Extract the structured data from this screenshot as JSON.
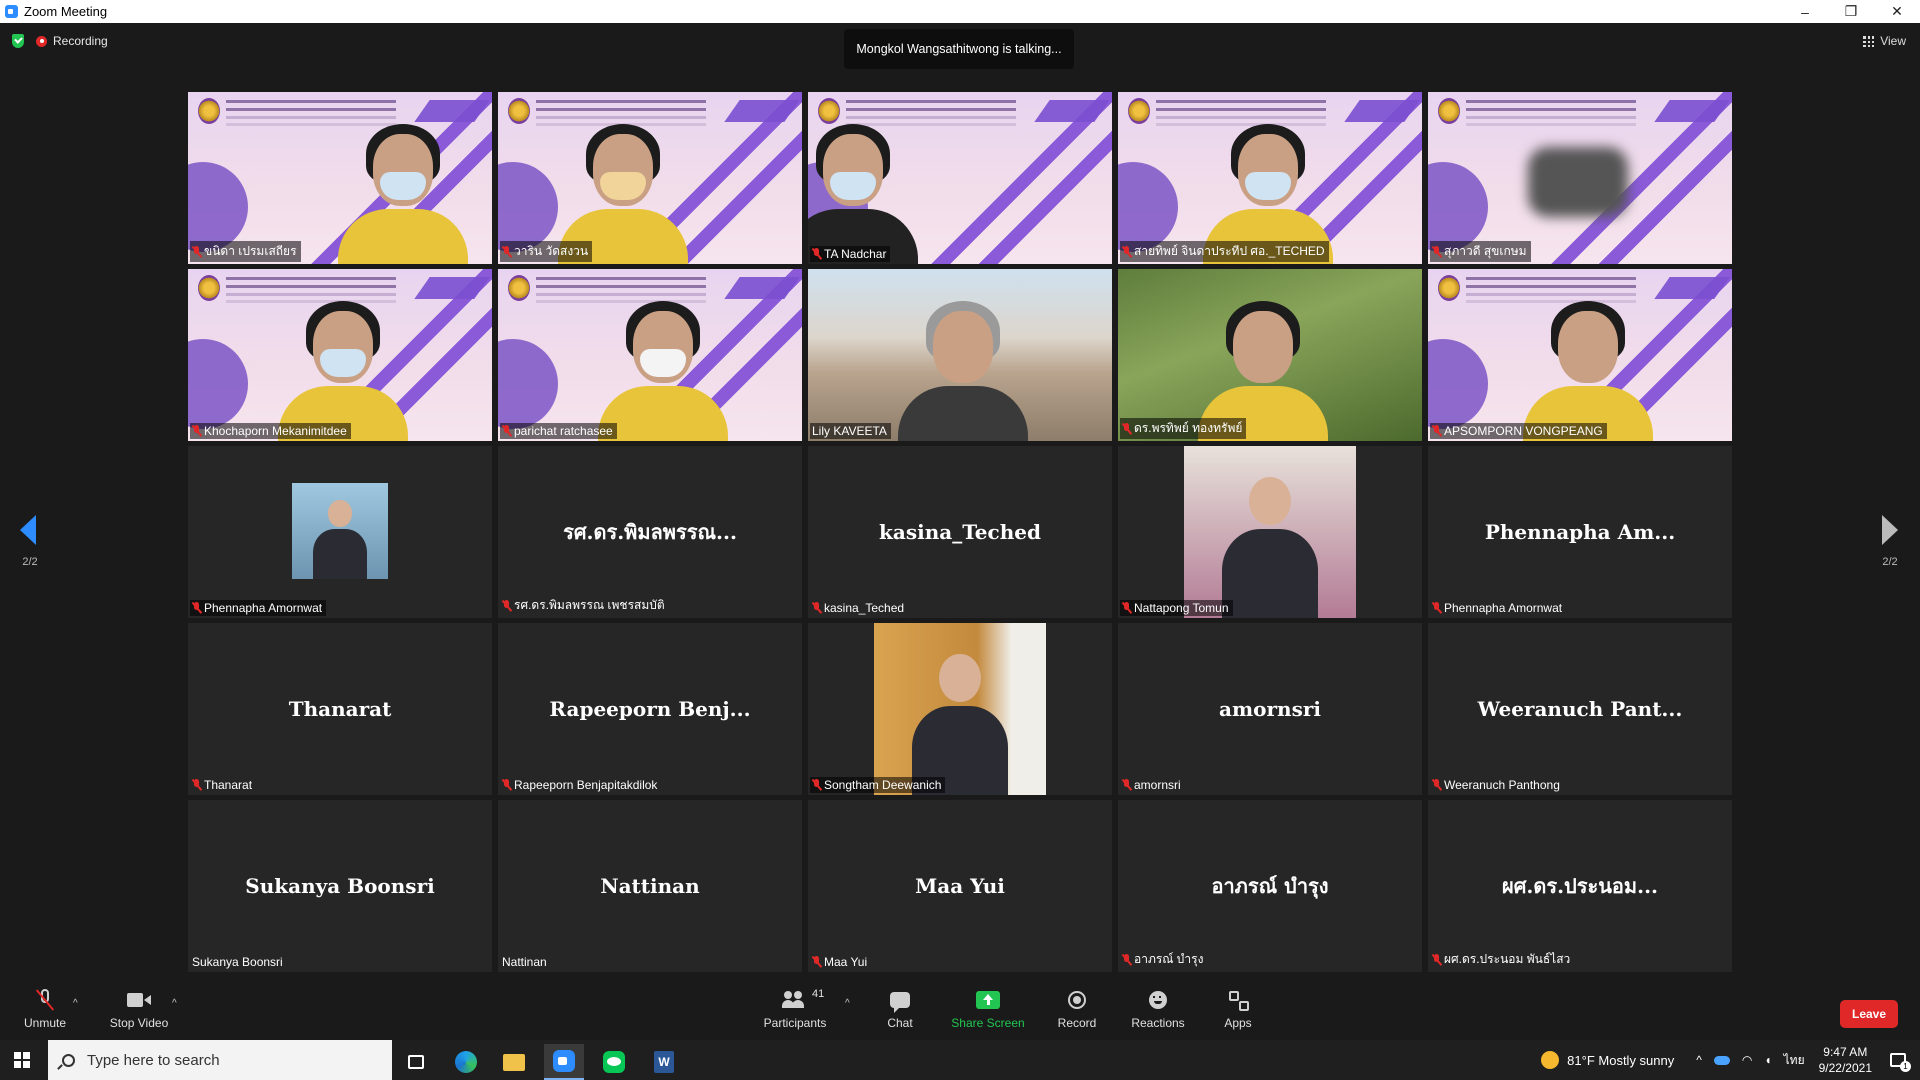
{
  "window": {
    "title": "Zoom Meeting",
    "controls": {
      "minimize": "–",
      "restore": "❐",
      "close": "✕"
    }
  },
  "top_bar": {
    "recording_label": "Recording",
    "talking_text": "Mongkol Wangsathitwong is talking...",
    "view_label": "View"
  },
  "pagination": {
    "left": "2/2",
    "right": "2/2"
  },
  "tiles": [
    {
      "name": "ขนิดา เปรมเสถียร",
      "kind": "video"
    },
    {
      "name": "วาริน วัดสงวน",
      "kind": "video"
    },
    {
      "name": "TA Nadchar",
      "kind": "video"
    },
    {
      "name": "สายทิพย์ จินดาประทีป ศอ._TECHED",
      "kind": "video"
    },
    {
      "name": "สุภาวดี สุขเกษม",
      "kind": "video"
    },
    {
      "name": "Khochaporn Mekanimitdee",
      "kind": "video"
    },
    {
      "name": "parichat ratchasee",
      "kind": "video"
    },
    {
      "name": "Lily KAVEETA",
      "kind": "video"
    },
    {
      "name": "ดร.พรทิพย์ ทองทรัพย์",
      "kind": "video"
    },
    {
      "name": "APSOMPORN VONGPEANG",
      "kind": "video"
    },
    {
      "name": "Phennapha Amornwat",
      "kind": "photo"
    },
    {
      "name": "รศ.ดร.พิมลพรรณ เพชรสมบัติ",
      "display_name": "รศ.ดร.พิมลพรรณ...",
      "kind": "name"
    },
    {
      "name": "kasina_Teched",
      "display_name": "kasina_Teched",
      "kind": "name"
    },
    {
      "name": "Nattapong Tomun",
      "kind": "photo"
    },
    {
      "name": "Phennapha  Amornwat",
      "display_name": "Phennapha  Am...",
      "kind": "name"
    },
    {
      "name": "Thanarat",
      "display_name": "Thanarat",
      "kind": "name"
    },
    {
      "name": "Rapeeporn Benjapitakdilok",
      "display_name": "Rapeeporn  Benj...",
      "kind": "name"
    },
    {
      "name": "Songtham Deewanich",
      "kind": "photo"
    },
    {
      "name": "amornsri",
      "display_name": "amornsri",
      "kind": "name"
    },
    {
      "name": "Weeranuch Panthong",
      "display_name": "Weeranuch  Pant...",
      "kind": "name"
    },
    {
      "name": "Sukanya Boonsri",
      "display_name": "Sukanya Boonsri",
      "kind": "name",
      "muted": false
    },
    {
      "name": "Nattinan",
      "display_name": "Nattinan",
      "kind": "name",
      "muted": false
    },
    {
      "name": "Maa Yui",
      "display_name": "Maa Yui",
      "kind": "name"
    },
    {
      "name": "อาภรณ์ บำรุง",
      "display_name": "อาภรณ์ บำรุง",
      "kind": "name"
    },
    {
      "name": "ผศ.ดร.ประนอม พันธ์ไสว",
      "display_name": "ผศ.ดร.ประนอม...",
      "kind": "name"
    }
  ],
  "toolbar": {
    "unmute": "Unmute",
    "stop_video": "Stop Video",
    "participants": "Participants",
    "participant_count": "41",
    "chat": "Chat",
    "share_screen": "Share Screen",
    "record": "Record",
    "reactions": "Reactions",
    "apps": "Apps",
    "leave": "Leave",
    "caret": "^"
  },
  "taskbar": {
    "search_placeholder": "Type here to search",
    "weather": "81°F  Mostly sunny",
    "language": "ไทย",
    "time": "9:47 AM",
    "date": "9/22/2021",
    "notification_count": "1",
    "word_letter": "W"
  },
  "colors": {
    "accent_blue": "#2d8cff",
    "share_green": "#23c552",
    "leave_red": "#e02828",
    "background": "#1a1a1a"
  }
}
